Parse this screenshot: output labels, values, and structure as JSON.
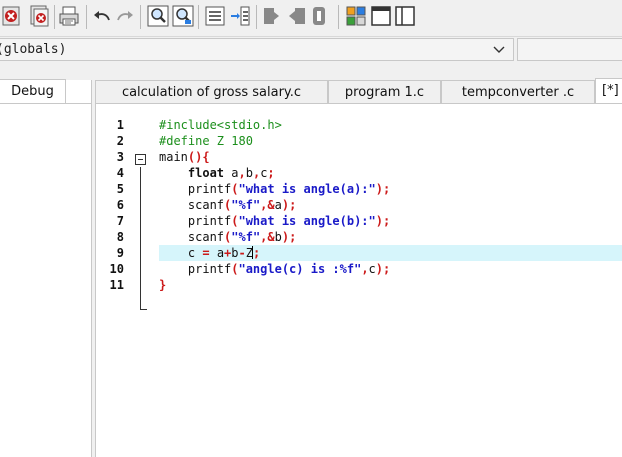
{
  "toolbar": {
    "icons": [
      "close-file-icon",
      "close-all-icon",
      "print-icon",
      "undo-icon",
      "redo-icon",
      "find-icon",
      "replace-icon",
      "indent-icon",
      "unindent-icon",
      "bookmark-icon",
      "bookmark-prev-icon",
      "bookmark-next-icon",
      "layout-icon",
      "window-icon"
    ]
  },
  "scope": {
    "value": "(globals)"
  },
  "left_tab": {
    "label": "Debug"
  },
  "tabs": [
    {
      "label": "calculation of gross salary.c"
    },
    {
      "label": "program 1.c"
    },
    {
      "label": "tempconverter .c"
    },
    {
      "label": "[*]"
    }
  ],
  "editor": {
    "lines": [
      {
        "num": "1",
        "parts": [
          [
            "pre",
            "#include<stdio.h>"
          ]
        ]
      },
      {
        "num": "2",
        "parts": [
          [
            "pre",
            "#define Z 180"
          ]
        ]
      },
      {
        "num": "3",
        "parts": [
          [
            "var",
            "main"
          ],
          [
            "red",
            "(){"
          ]
        ]
      },
      {
        "num": "4",
        "parts": [
          [
            "var",
            "    "
          ],
          [
            "kw",
            "float"
          ],
          [
            "var",
            " a"
          ],
          [
            "red",
            ","
          ],
          [
            "var",
            "b"
          ],
          [
            "red",
            ","
          ],
          [
            "var",
            "c"
          ],
          [
            "red",
            ";"
          ]
        ]
      },
      {
        "num": "5",
        "parts": [
          [
            "var",
            "    printf"
          ],
          [
            "red",
            "("
          ],
          [
            "str",
            "\"what is angle(a):\""
          ],
          [
            "red",
            ");"
          ]
        ]
      },
      {
        "num": "6",
        "parts": [
          [
            "var",
            "    scanf"
          ],
          [
            "red",
            "("
          ],
          [
            "str",
            "\"%f\""
          ],
          [
            "red",
            ",&"
          ],
          [
            "var",
            "a"
          ],
          [
            "red",
            ");"
          ]
        ]
      },
      {
        "num": "7",
        "parts": [
          [
            "var",
            "    printf"
          ],
          [
            "red",
            "("
          ],
          [
            "str",
            "\"what is angle(b):\""
          ],
          [
            "red",
            ");"
          ]
        ]
      },
      {
        "num": "8",
        "parts": [
          [
            "var",
            "    scanf"
          ],
          [
            "red",
            "("
          ],
          [
            "str",
            "\"%f\""
          ],
          [
            "red",
            ",&"
          ],
          [
            "var",
            "b"
          ],
          [
            "red",
            ");"
          ]
        ]
      },
      {
        "num": "9",
        "parts": [
          [
            "var",
            "    c "
          ],
          [
            "red",
            "="
          ],
          [
            "var",
            " a"
          ],
          [
            "red",
            "+"
          ],
          [
            "var",
            "b"
          ],
          [
            "red",
            "-"
          ],
          [
            "var",
            "Z"
          ],
          [
            "caret",
            ""
          ],
          [
            "red",
            ";"
          ]
        ]
      },
      {
        "num": "10",
        "parts": [
          [
            "var",
            "    printf"
          ],
          [
            "red",
            "("
          ],
          [
            "str",
            "\"angle(c) is :%f\""
          ],
          [
            "red",
            ","
          ],
          [
            "var",
            "c"
          ],
          [
            "red",
            ");"
          ]
        ]
      },
      {
        "num": "11",
        "parts": [
          [
            "red",
            "}"
          ]
        ]
      }
    ],
    "highlight_line": 9
  }
}
